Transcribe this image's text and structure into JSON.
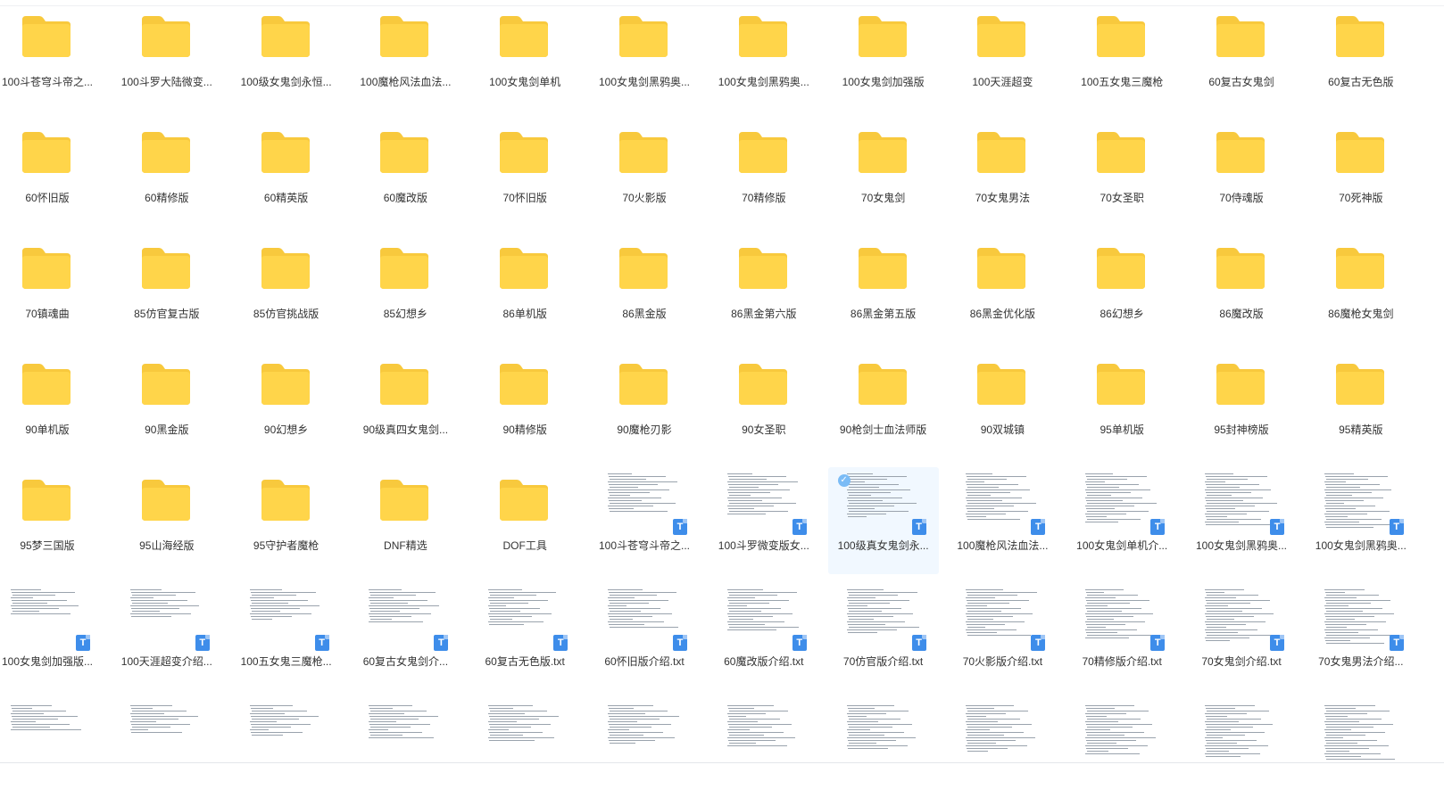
{
  "files": [
    {
      "name": "100斗苍穹斗帝之...",
      "type": "folder",
      "icon": "folder-icon"
    },
    {
      "name": "100斗罗大陆微变...",
      "type": "folder",
      "icon": "folder-icon"
    },
    {
      "name": "100级女鬼剑永恒...",
      "type": "folder",
      "icon": "folder-icon"
    },
    {
      "name": "100魔枪风法血法...",
      "type": "folder",
      "icon": "folder-icon"
    },
    {
      "name": "100女鬼剑单机",
      "type": "folder",
      "icon": "folder-icon"
    },
    {
      "name": "100女鬼剑黑鸦奥...",
      "type": "folder",
      "icon": "folder-icon"
    },
    {
      "name": "100女鬼剑黑鸦奥...",
      "type": "folder",
      "icon": "folder-icon"
    },
    {
      "name": "100女鬼剑加强版",
      "type": "folder",
      "icon": "folder-icon"
    },
    {
      "name": "100天涯超变",
      "type": "folder",
      "icon": "folder-icon"
    },
    {
      "name": "100五女鬼三魔枪",
      "type": "folder",
      "icon": "folder-icon"
    },
    {
      "name": "60复古女鬼剑",
      "type": "folder",
      "icon": "folder-icon"
    },
    {
      "name": "60复古无色版",
      "type": "folder",
      "icon": "folder-icon"
    },
    {
      "name": "60怀旧版",
      "type": "folder",
      "icon": "folder-icon"
    },
    {
      "name": "60精修版",
      "type": "folder",
      "icon": "folder-icon"
    },
    {
      "name": "60精英版",
      "type": "folder",
      "icon": "folder-icon"
    },
    {
      "name": "60魔改版",
      "type": "folder",
      "icon": "folder-icon"
    },
    {
      "name": "70怀旧版",
      "type": "folder",
      "icon": "folder-icon"
    },
    {
      "name": "70火影版",
      "type": "folder",
      "icon": "folder-icon"
    },
    {
      "name": "70精修版",
      "type": "folder",
      "icon": "folder-icon"
    },
    {
      "name": "70女鬼剑",
      "type": "folder",
      "icon": "folder-icon"
    },
    {
      "name": "70女鬼男法",
      "type": "folder",
      "icon": "folder-icon"
    },
    {
      "name": "70女圣职",
      "type": "folder",
      "icon": "folder-icon"
    },
    {
      "name": "70侍魂版",
      "type": "folder",
      "icon": "folder-icon"
    },
    {
      "name": "70死神版",
      "type": "folder",
      "icon": "folder-icon"
    },
    {
      "name": "70镇魂曲",
      "type": "folder",
      "icon": "folder-icon"
    },
    {
      "name": "85仿官复古版",
      "type": "folder",
      "icon": "folder-icon"
    },
    {
      "name": "85仿官挑战版",
      "type": "folder",
      "icon": "folder-icon"
    },
    {
      "name": "85幻想乡",
      "type": "folder",
      "icon": "folder-icon"
    },
    {
      "name": "86单机版",
      "type": "folder",
      "icon": "folder-icon"
    },
    {
      "name": "86黑金版",
      "type": "folder",
      "icon": "folder-icon"
    },
    {
      "name": "86黑金第六版",
      "type": "folder",
      "icon": "folder-icon"
    },
    {
      "name": "86黑金第五版",
      "type": "folder",
      "icon": "folder-icon"
    },
    {
      "name": "86黑金优化版",
      "type": "folder",
      "icon": "folder-icon"
    },
    {
      "name": "86幻想乡",
      "type": "folder",
      "icon": "folder-icon"
    },
    {
      "name": "86魔改版",
      "type": "folder",
      "icon": "folder-icon"
    },
    {
      "name": "86魔枪女鬼剑",
      "type": "folder",
      "icon": "folder-icon"
    },
    {
      "name": "90单机版",
      "type": "folder",
      "icon": "folder-icon"
    },
    {
      "name": "90黑金版",
      "type": "folder",
      "icon": "folder-icon"
    },
    {
      "name": "90幻想乡",
      "type": "folder",
      "icon": "folder-icon"
    },
    {
      "name": "90级真四女鬼剑...",
      "type": "folder",
      "icon": "folder-icon"
    },
    {
      "name": "90精修版",
      "type": "folder",
      "icon": "folder-icon"
    },
    {
      "name": "90魔枪刃影",
      "type": "folder",
      "icon": "folder-icon"
    },
    {
      "name": "90女圣职",
      "type": "folder",
      "icon": "folder-icon"
    },
    {
      "name": "90枪剑士血法师版",
      "type": "folder",
      "icon": "folder-icon"
    },
    {
      "name": "90双城镇",
      "type": "folder",
      "icon": "folder-icon"
    },
    {
      "name": "95单机版",
      "type": "folder",
      "icon": "folder-icon"
    },
    {
      "name": "95封神榜版",
      "type": "folder",
      "icon": "folder-icon"
    },
    {
      "name": "95精英版",
      "type": "folder",
      "icon": "folder-icon"
    },
    {
      "name": "95梦三国版",
      "type": "folder",
      "icon": "folder-icon"
    },
    {
      "name": "95山海经版",
      "type": "folder",
      "icon": "folder-icon"
    },
    {
      "name": "95守护者魔枪",
      "type": "folder",
      "icon": "folder-icon"
    },
    {
      "name": "DNF精选",
      "type": "folder",
      "icon": "folder-icon"
    },
    {
      "name": "DOF工具",
      "type": "folder",
      "icon": "folder-icon"
    },
    {
      "name": "100斗苍穹斗帝之...",
      "type": "txt",
      "icon": "text-file-icon",
      "badge": "T"
    },
    {
      "name": "100斗罗微变版女...",
      "type": "txt",
      "icon": "text-file-icon",
      "badge": "T"
    },
    {
      "name": "100级真女鬼剑永...",
      "type": "txt",
      "icon": "text-file-icon",
      "badge": "T",
      "selected": true
    },
    {
      "name": "100魔枪风法血法...",
      "type": "txt",
      "icon": "text-file-icon",
      "badge": "T"
    },
    {
      "name": "100女鬼剑单机介...",
      "type": "txt",
      "icon": "text-file-icon",
      "badge": "T"
    },
    {
      "name": "100女鬼剑黑鸦奥...",
      "type": "txt",
      "icon": "text-file-icon",
      "badge": "T"
    },
    {
      "name": "100女鬼剑黑鸦奥...",
      "type": "txt",
      "icon": "text-file-icon",
      "badge": "T"
    },
    {
      "name": "100女鬼剑加强版...",
      "type": "txt",
      "icon": "text-file-icon",
      "badge": "T"
    },
    {
      "name": "100天涯超变介绍...",
      "type": "txt",
      "icon": "text-file-icon",
      "badge": "T"
    },
    {
      "name": "100五女鬼三魔枪...",
      "type": "txt",
      "icon": "text-file-icon",
      "badge": "T"
    },
    {
      "name": "60复古女鬼剑介...",
      "type": "txt",
      "icon": "text-file-icon",
      "badge": "T"
    },
    {
      "name": "60复古无色版.txt",
      "type": "txt",
      "icon": "text-file-icon",
      "badge": "T"
    },
    {
      "name": "60怀旧版介绍.txt",
      "type": "txt",
      "icon": "text-file-icon",
      "badge": "T"
    },
    {
      "name": "60魔改版介绍.txt",
      "type": "txt",
      "icon": "text-file-icon",
      "badge": "T"
    },
    {
      "name": "70仿官版介绍.txt",
      "type": "txt",
      "icon": "text-file-icon",
      "badge": "T"
    },
    {
      "name": "70火影版介绍.txt",
      "type": "txt",
      "icon": "text-file-icon",
      "badge": "T"
    },
    {
      "name": "70精修版介绍.txt",
      "type": "txt",
      "icon": "text-file-icon",
      "badge": "T"
    },
    {
      "name": "70女鬼剑介绍.txt",
      "type": "txt",
      "icon": "text-file-icon",
      "badge": "T"
    },
    {
      "name": "70女鬼男法介绍...",
      "type": "txt",
      "icon": "text-file-icon",
      "badge": "T"
    },
    {
      "name": "",
      "type": "txt",
      "icon": "text-file-icon"
    },
    {
      "name": "",
      "type": "txt",
      "icon": "text-file-icon"
    },
    {
      "name": "",
      "type": "txt",
      "icon": "text-file-icon"
    },
    {
      "name": "",
      "type": "txt",
      "icon": "text-file-icon"
    },
    {
      "name": "",
      "type": "txt",
      "icon": "text-file-icon"
    },
    {
      "name": "",
      "type": "txt",
      "icon": "text-file-icon"
    },
    {
      "name": "",
      "type": "txt",
      "icon": "text-file-icon"
    },
    {
      "name": "",
      "type": "txt",
      "icon": "text-file-icon"
    },
    {
      "name": "",
      "type": "txt",
      "icon": "text-file-icon"
    },
    {
      "name": "",
      "type": "txt",
      "icon": "text-file-icon"
    },
    {
      "name": "",
      "type": "txt",
      "icon": "text-file-icon"
    },
    {
      "name": "",
      "type": "txt",
      "icon": "text-file-icon"
    }
  ],
  "colors": {
    "folder": "#ffd54a",
    "folder_tab": "#f8c93d",
    "badge": "#3e8dea",
    "selected_bg": "#f1f8ff"
  }
}
